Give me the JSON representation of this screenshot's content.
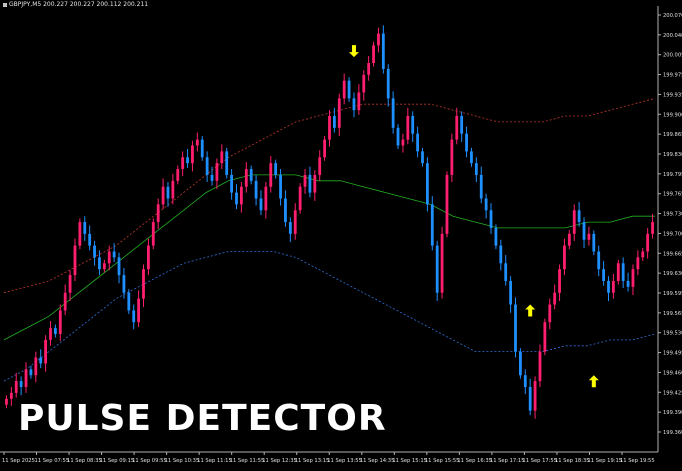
{
  "header": {
    "symbol_line": "GBPJPY,M5  200.227 200.227 200.112 200.211"
  },
  "watermark": "PULSE DETECTOR",
  "colors": {
    "background": "#000000",
    "bull": "#ff1f6e",
    "bear": "#1e90ff",
    "upper_band": "#c0392b",
    "middle_band": "#22b022",
    "lower_band": "#2f6fd6",
    "arrow": "#ffff00"
  },
  "chart_data": {
    "type": "candlestick",
    "y_axis": {
      "min": 199.35,
      "max": 200.08,
      "ticks": [
        "200.070",
        "200.040",
        "200.005",
        "199.975",
        "199.935",
        "199.900",
        "199.865",
        "199.830",
        "199.795",
        "199.765",
        "199.730",
        "199.700",
        "199.665",
        "199.630",
        "199.595",
        "199.565",
        "199.530",
        "199.495",
        "199.460",
        "199.425",
        "199.390",
        "199.360"
      ]
    },
    "x_axis": {
      "ticks": [
        "11 Sep 2025",
        "11 Sep 07:55",
        "11 Sep 08:35",
        "11 Sep 09:15",
        "11 Sep 09:55",
        "11 Sep 10:35",
        "11 Sep 11:15",
        "11 Sep 11:55",
        "11 Sep 12:35",
        "11 Sep 13:15",
        "11 Sep 13:55",
        "11 Sep 14:35",
        "11 Sep 15:15",
        "11 Sep 15:55",
        "11 Sep 16:35",
        "11 Sep 17:15",
        "11 Sep 17:55",
        "11 Sep 18:35",
        "11 Sep 19:15",
        "11 Sep 19:55"
      ]
    },
    "close_series": [
      199.42,
      199.43,
      199.45,
      199.44,
      199.47,
      199.46,
      199.49,
      199.48,
      199.52,
      199.54,
      199.53,
      199.57,
      199.6,
      199.63,
      199.68,
      199.72,
      199.7,
      199.68,
      199.66,
      199.64,
      199.65,
      199.67,
      199.66,
      199.63,
      199.6,
      199.57,
      199.55,
      199.59,
      199.64,
      199.68,
      199.72,
      199.75,
      199.78,
      199.76,
      199.79,
      199.81,
      199.83,
      199.82,
      199.85,
      199.86,
      199.83,
      199.8,
      199.79,
      199.82,
      199.84,
      199.8,
      199.77,
      199.75,
      199.78,
      199.81,
      199.79,
      199.76,
      199.74,
      199.78,
      199.82,
      199.8,
      199.76,
      199.72,
      199.7,
      199.74,
      199.78,
      199.8,
      199.77,
      199.8,
      199.83,
      199.86,
      199.9,
      199.88,
      199.93,
      199.96,
      199.93,
      199.91,
      199.94,
      199.97,
      199.99,
      200.02,
      200.04,
      199.98,
      199.93,
      199.88,
      199.85,
      199.86,
      199.9,
      199.87,
      199.84,
      199.82,
      199.75,
      199.68,
      199.6,
      199.7,
      199.8,
      199.86,
      199.9,
      199.87,
      199.84,
      199.82,
      199.8,
      199.76,
      199.74,
      199.71,
      199.68,
      199.65,
      199.62,
      199.58,
      199.5,
      199.46,
      199.44,
      199.4,
      199.45,
      199.5,
      199.55,
      199.58,
      199.6,
      199.64,
      199.68,
      199.7,
      199.74,
      199.72,
      199.69,
      199.7,
      199.67,
      199.64,
      199.62,
      199.6,
      199.62,
      199.65,
      199.62,
      199.61,
      199.64,
      199.66,
      199.67,
      199.7,
      199.72
    ],
    "upper_band": [
      199.6,
      199.61,
      199.62,
      199.64,
      199.66,
      199.68,
      199.71,
      199.74,
      199.77,
      199.8,
      199.83,
      199.85,
      199.87,
      199.89,
      199.9,
      199.91,
      199.92,
      199.92,
      199.92,
      199.92,
      199.91,
      199.9,
      199.89,
      199.89,
      199.89,
      199.9,
      199.9,
      199.91,
      199.92,
      199.93
    ],
    "middle_band": [
      199.52,
      199.54,
      199.56,
      199.59,
      199.62,
      199.65,
      199.68,
      199.71,
      199.74,
      199.77,
      199.79,
      199.8,
      199.8,
      199.8,
      199.79,
      199.79,
      199.78,
      199.77,
      199.76,
      199.75,
      199.73,
      199.72,
      199.71,
      199.71,
      199.71,
      199.71,
      199.72,
      199.72,
      199.73,
      199.73
    ],
    "lower_band": [
      199.45,
      199.47,
      199.5,
      199.53,
      199.56,
      199.59,
      199.61,
      199.63,
      199.65,
      199.66,
      199.67,
      199.67,
      199.67,
      199.66,
      199.64,
      199.62,
      199.6,
      199.58,
      199.56,
      199.54,
      199.52,
      199.5,
      199.5,
      199.5,
      199.5,
      199.51,
      199.51,
      199.52,
      199.52,
      199.53
    ],
    "arrows": [
      {
        "index": 71,
        "direction": "down",
        "price": 200.0
      },
      {
        "index": 107,
        "direction": "up",
        "price": 199.58
      },
      {
        "index": 120,
        "direction": "up",
        "price": 199.46
      }
    ]
  }
}
